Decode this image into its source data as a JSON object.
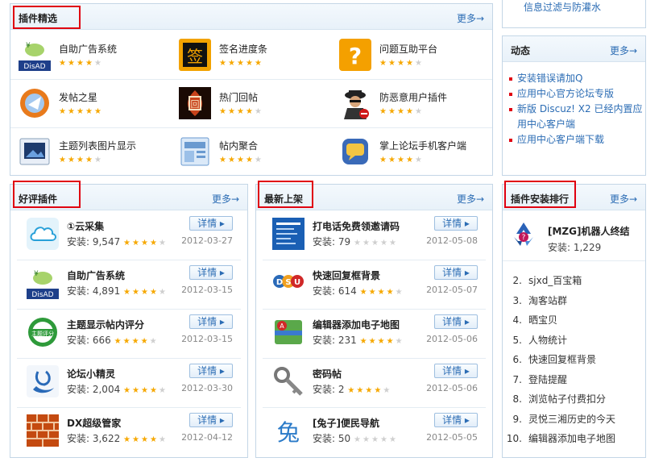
{
  "top_link": "信息过滤与防灌水",
  "featured": {
    "title": "插件精选",
    "more": "更多→",
    "items": [
      {
        "name": "自助广告系统",
        "rating": 4.5,
        "icon": "disad-ad-icon"
      },
      {
        "name": "签名进度条",
        "rating": 5,
        "icon": "signature-icon"
      },
      {
        "name": "问题互助平台",
        "rating": 4.5,
        "icon": "question-mark-icon"
      },
      {
        "name": "发帖之星",
        "rating": 5,
        "icon": "post-star-icon"
      },
      {
        "name": "热门回帖",
        "rating": 4,
        "icon": "hot-reply-icon"
      },
      {
        "name": "防恶意用户插件",
        "rating": 4.5,
        "icon": "spy-user-icon"
      },
      {
        "name": "主题列表图片显示",
        "rating": 4.5,
        "icon": "image-list-icon"
      },
      {
        "name": "帖内聚合",
        "rating": 4.5,
        "icon": "aggregate-icon"
      },
      {
        "name": "掌上论坛手机客户端",
        "rating": 4.5,
        "icon": "mobile-chat-icon"
      }
    ]
  },
  "news": {
    "title": "动态",
    "more": "更多→",
    "items": [
      "安装错误请加Q",
      "应用中心官方论坛专版",
      "新版 Discuz! X2 已经内置应用中心客户端",
      "应用中心客户端下载"
    ]
  },
  "good_plugins": {
    "title": "好评插件",
    "more": "更多→",
    "detail_label": "详情",
    "items": [
      {
        "name": "①云采集",
        "install": "安装: 9,547",
        "rating": 4.5,
        "date": "2012-03-27",
        "icon": "cloud-icon"
      },
      {
        "name": "自助广告系统",
        "install": "安装: 4,891",
        "rating": 4.5,
        "date": "2012-03-15",
        "icon": "disad-ad-icon"
      },
      {
        "name": "主题显示帖内评分",
        "install": "安装: 666",
        "rating": 4.5,
        "date": "2012-03-15",
        "icon": "rating-badge-icon"
      },
      {
        "name": "论坛小精灵",
        "install": "安装: 2,004",
        "rating": 4.5,
        "date": "2012-03-30",
        "icon": "sprite-icon"
      },
      {
        "name": "DX超级管家",
        "install": "安装: 3,622",
        "rating": 4.5,
        "date": "2012-04-12",
        "icon": "brick-wall-icon"
      }
    ]
  },
  "new_plugins": {
    "title": "最新上架",
    "more": "更多→",
    "detail_label": "详情",
    "items": [
      {
        "name": "打电话免费领邀请码",
        "install": "安装: 79",
        "rating": 0.5,
        "date": "2012-05-08",
        "icon": "phone-invite-icon"
      },
      {
        "name": "快速回复框背景",
        "install": "安装: 614",
        "rating": 4.5,
        "date": "2012-05-07",
        "icon": "dsu-icon"
      },
      {
        "name": "编辑器添加电子地图",
        "install": "安装: 231",
        "rating": 4.5,
        "date": "2012-05-06",
        "icon": "map-icon"
      },
      {
        "name": "密码帖",
        "install": "安装: 2",
        "rating": 4.5,
        "date": "2012-05-06",
        "icon": "key-icon"
      },
      {
        "name": "[兔子]便民导航",
        "install": "安装: 50",
        "rating": 0.5,
        "date": "2012-05-05",
        "icon": "rabbit-nav-icon"
      }
    ]
  },
  "install_rank": {
    "title": "插件安装排行",
    "more": "更多→",
    "top": {
      "name": "[MZG]机器人终结",
      "install": "安装: 1,229",
      "icon": "recycle-robot-icon"
    },
    "items": [
      {
        "num": "2.",
        "name": "sjxd_百宝箱"
      },
      {
        "num": "3.",
        "name": "淘客站群"
      },
      {
        "num": "4.",
        "name": "晒宝贝"
      },
      {
        "num": "5.",
        "name": "人物统计"
      },
      {
        "num": "6.",
        "name": "快速回复框背景"
      },
      {
        "num": "7.",
        "name": "登陆提醒"
      },
      {
        "num": "8.",
        "name": "浏览帖子付费扣分"
      },
      {
        "num": "9.",
        "name": "灵悦三湘历史的今天"
      },
      {
        "num": "10.",
        "name": "编辑器添加电子地图"
      }
    ]
  }
}
